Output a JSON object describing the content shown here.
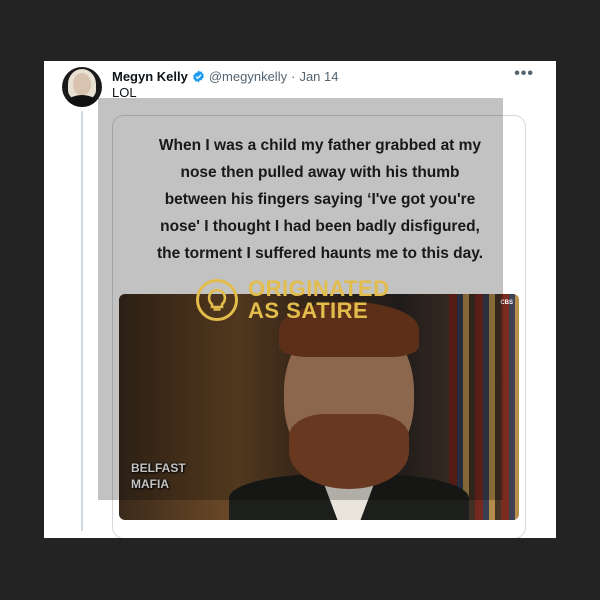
{
  "tweet": {
    "author_name": "Megyn Kelly",
    "handle": "@megynkelly",
    "separator": "·",
    "date": "Jan 14",
    "text": "LOL",
    "more_label": "•••"
  },
  "media": {
    "caption_lines": [
      "When I was a child my father grabbed at my",
      "nose then pulled away with his thumb",
      "between his fingers saying ‘I've got you're",
      "nose' I thought I had been badly disfigured,",
      "the torment I suffered haunts me to this day."
    ],
    "photo_label_lines": [
      "BELFAST",
      "MAFIA"
    ],
    "network_bug": "CBS"
  },
  "badge": {
    "line1": "ORIGINATED",
    "line2": "AS SATIRE",
    "color": "#e3bd4c"
  },
  "colors": {
    "background": "#232323",
    "verified": "#1d9bf0",
    "muted": "#536471"
  },
  "icons": [
    "verified-badge-icon",
    "more-options-icon",
    "satire-lightbulb-icon"
  ]
}
